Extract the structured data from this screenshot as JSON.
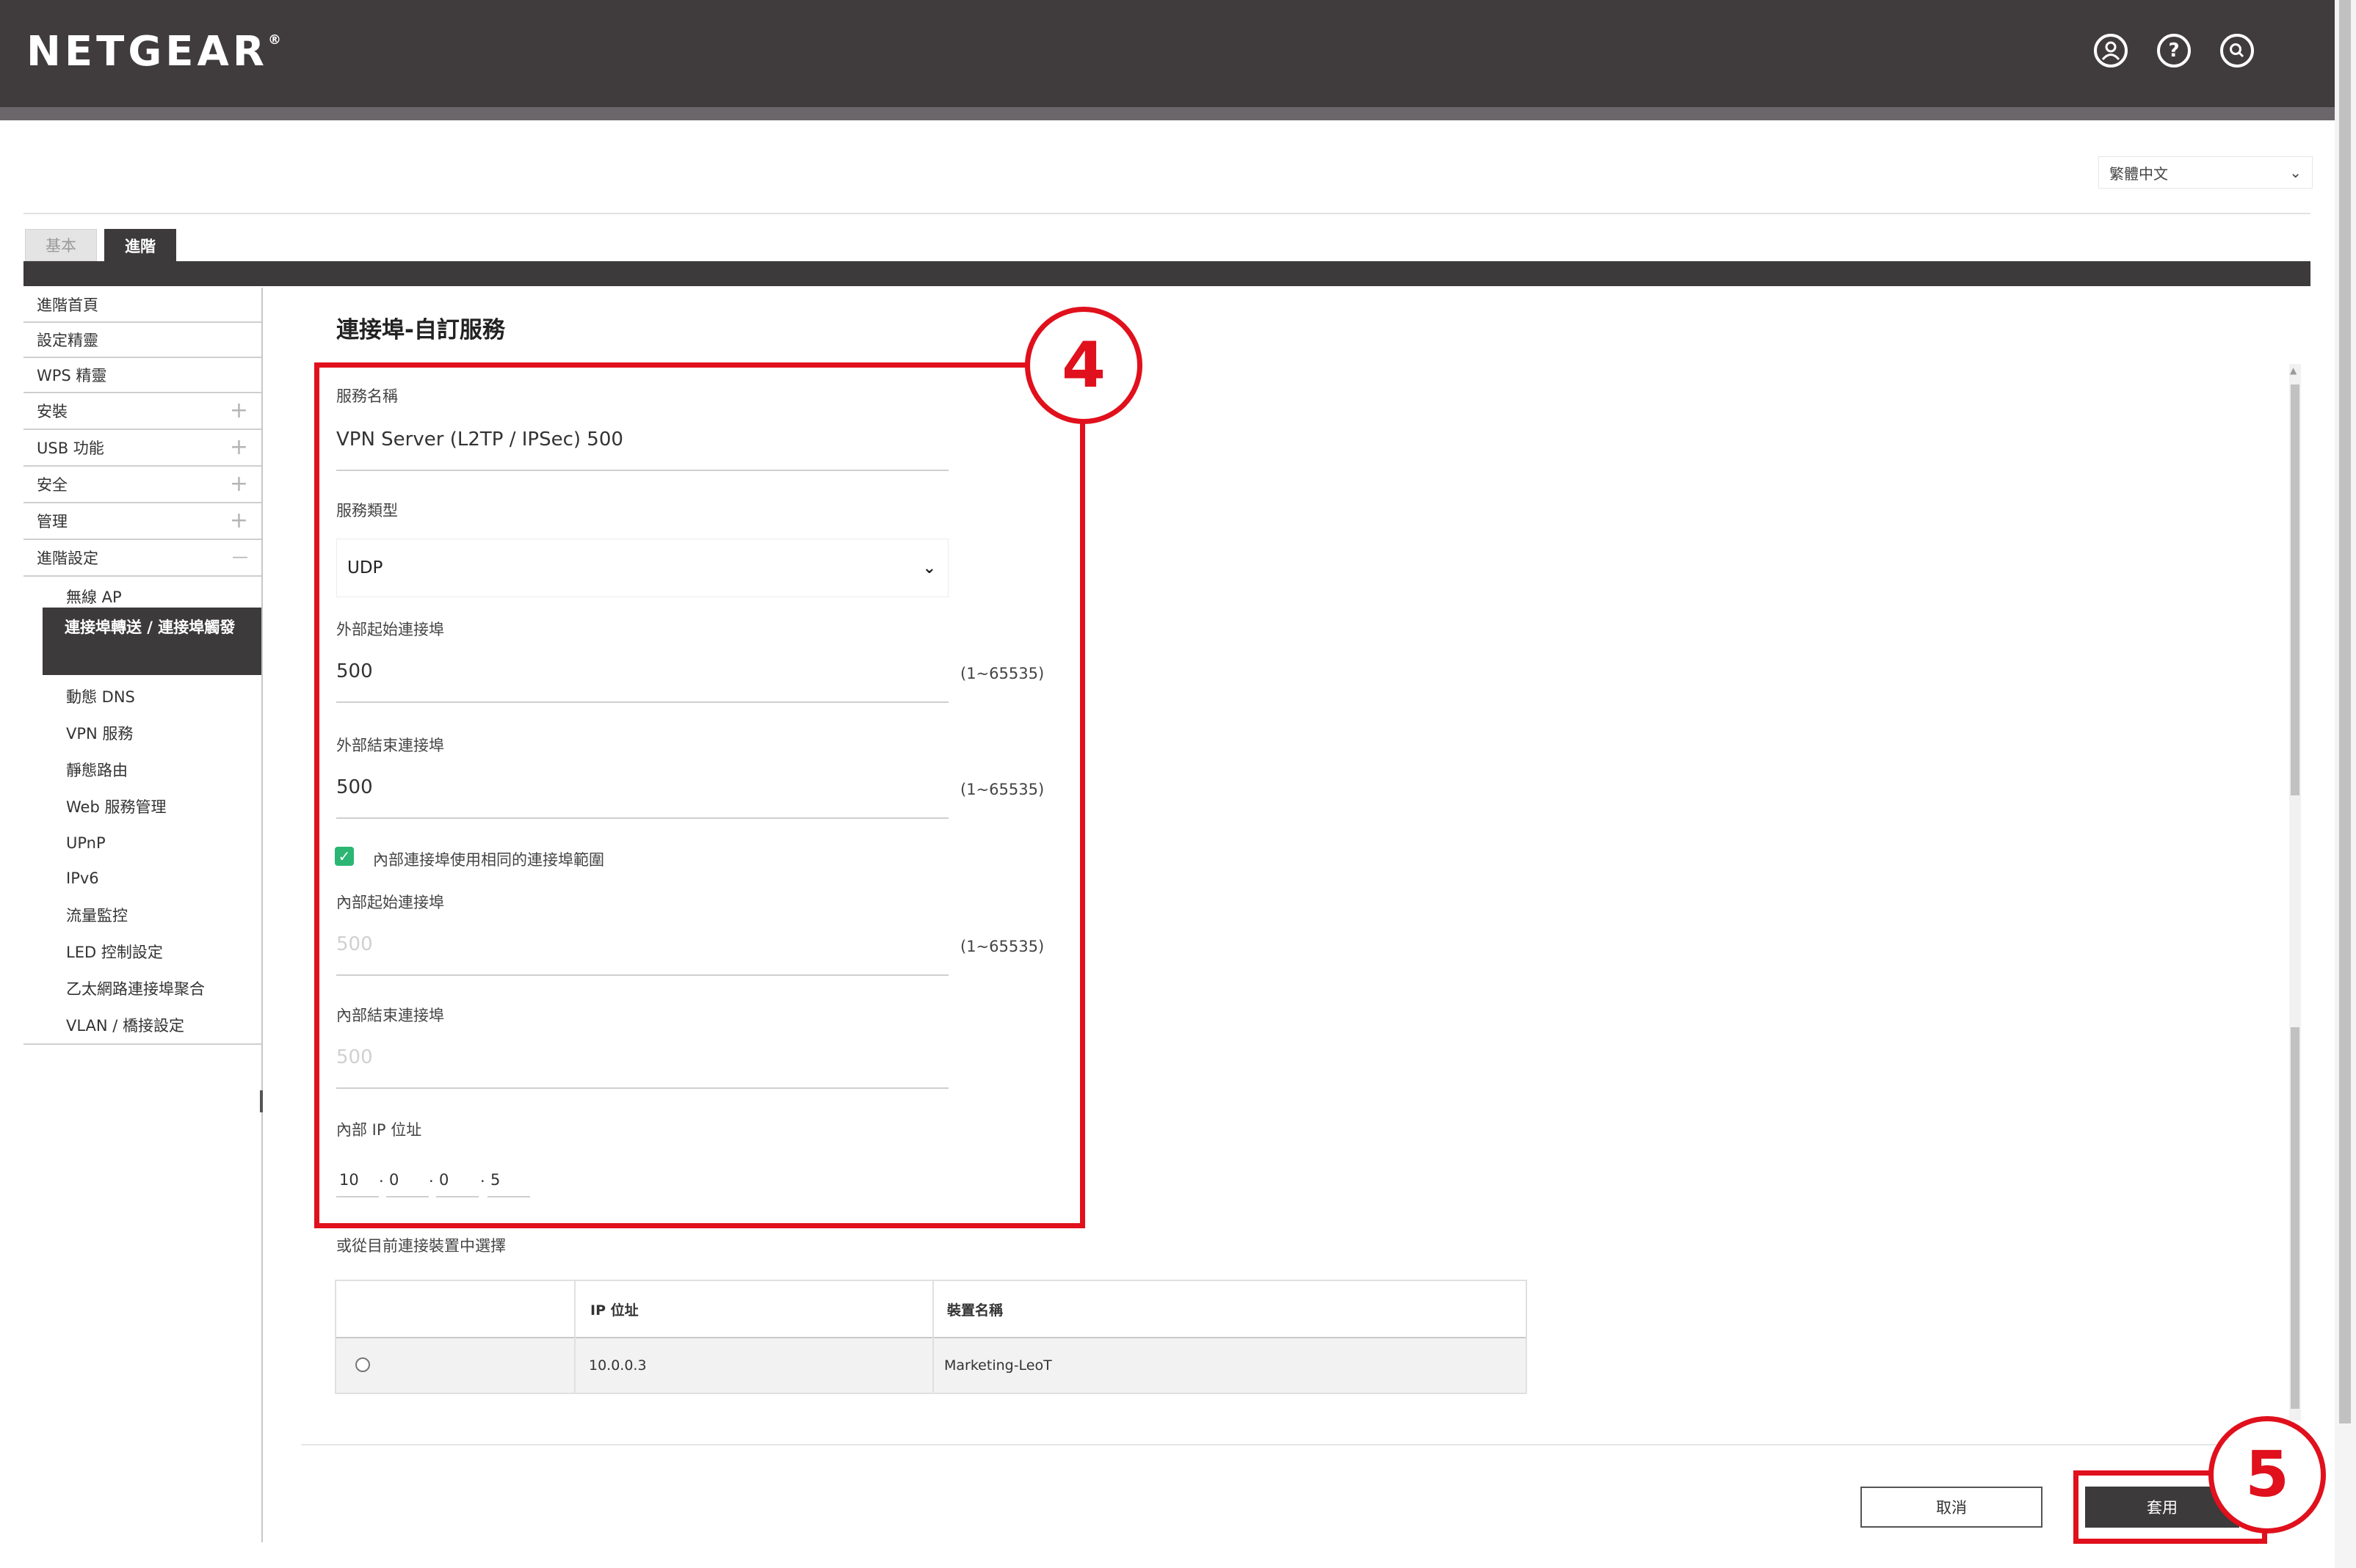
{
  "header": {
    "brand": "NETGEAR",
    "brand_mark": "®",
    "icons": [
      "user-icon",
      "help-icon",
      "search-icon"
    ]
  },
  "language": {
    "selected": "繁體中文"
  },
  "tabs": {
    "basic": "基本",
    "advanced": "進階"
  },
  "sidebar": {
    "items": [
      {
        "label": "進階首頁",
        "expandable": false
      },
      {
        "label": "設定精靈",
        "expandable": false
      },
      {
        "label": "WPS 精靈",
        "expandable": false
      },
      {
        "label": "安裝",
        "expandable": true,
        "sign": "+"
      },
      {
        "label": "USB 功能",
        "expandable": true,
        "sign": "+"
      },
      {
        "label": "安全",
        "expandable": true,
        "sign": "+"
      },
      {
        "label": "管理",
        "expandable": true,
        "sign": "+"
      },
      {
        "label": "進階設定",
        "expandable": true,
        "sign": "—"
      }
    ],
    "sub_items": [
      "無線 AP",
      "連接埠轉送 / 連接埠觸發",
      "動態 DNS",
      "VPN 服務",
      "靜態路由",
      "Web 服務管理",
      "UPnP",
      "IPv6",
      "流量監控",
      "LED 控制設定",
      "乙太網路連接埠聚合",
      "VLAN / 橋接設定"
    ],
    "active_sub": "連接埠轉送 / 連接埠觸發"
  },
  "main": {
    "title": "連接埠-自訂服務",
    "service_name_label": "服務名稱",
    "service_name_value": "VPN Server (L2TP / IPSec) 500",
    "service_type_label": "服務類型",
    "service_type_value": "UDP",
    "ext_start_label": "外部起始連接埠",
    "ext_start_value": "500",
    "ext_end_label": "外部結束連接埠",
    "ext_end_value": "500",
    "range_hint": "(1~65535)",
    "same_range_label": "內部連接埠使用相同的連接埠範圍",
    "same_range_checked": true,
    "int_start_label": "內部起始連接埠",
    "int_start_value": "500",
    "int_end_label": "內部結束連接埠",
    "int_end_value": "500",
    "ip_label": "內部 IP 位址",
    "ip_octets": [
      "10",
      "0",
      "0",
      "5"
    ],
    "or_select_label": "或從目前連接裝置中選擇"
  },
  "device_table": {
    "headers": [
      "",
      "IP 位址",
      "裝置名稱"
    ],
    "rows": [
      {
        "ip": "10.0.0.3",
        "name": "Marketing-LeoT"
      }
    ]
  },
  "buttons": {
    "cancel": "取消",
    "apply": "套用"
  },
  "annotations": {
    "step_a": "4",
    "step_b": "5"
  },
  "colors": {
    "header_bg": "#403c3e",
    "accent_annotation": "#e0101c",
    "checkbox": "#2bb673"
  }
}
